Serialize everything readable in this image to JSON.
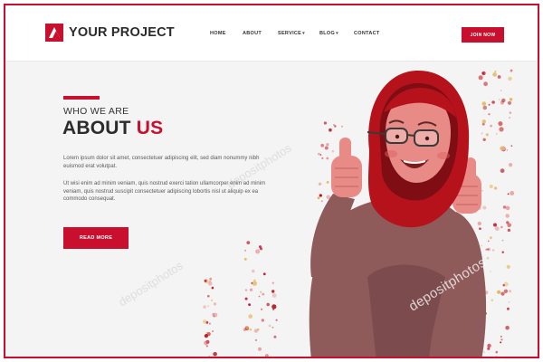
{
  "brand": {
    "logo_text": "YOUR PROJECT",
    "accent_color": "#c8102e"
  },
  "nav": {
    "items": [
      {
        "label": "HOME",
        "has_dropdown": false
      },
      {
        "label": "ABOUT",
        "has_dropdown": false
      },
      {
        "label": "SERVICE",
        "has_dropdown": true
      },
      {
        "label": "BLOG",
        "has_dropdown": true
      },
      {
        "label": "CONTACT",
        "has_dropdown": false
      }
    ],
    "cta_label": "JOIN NOW"
  },
  "hero": {
    "eyebrow": "WHO WE ARE",
    "title_main": "ABOUT ",
    "title_highlight": "US",
    "paragraph_1": "Lorem ipsum dolor sit amet, consectetuer adipiscing elit, sed diam nonummy nibh euismod erat volutpat.",
    "paragraph_2": "Ut wisi enim ad minim veniam, quis nostrud exerci tation ullamcorper enim ad minim veniam, quis nostrud suscipit consectetuer adipiscing lobortis nisl ut aliquip ex ea commodo consequat.",
    "button_label": "READ MORE"
  },
  "illustration": {
    "subject": "woman-in-hijab-thumbs-up",
    "hijab_color": "#b5121b",
    "dress_color": "#8e5a5a"
  },
  "watermark": {
    "text": "depositphotos"
  }
}
